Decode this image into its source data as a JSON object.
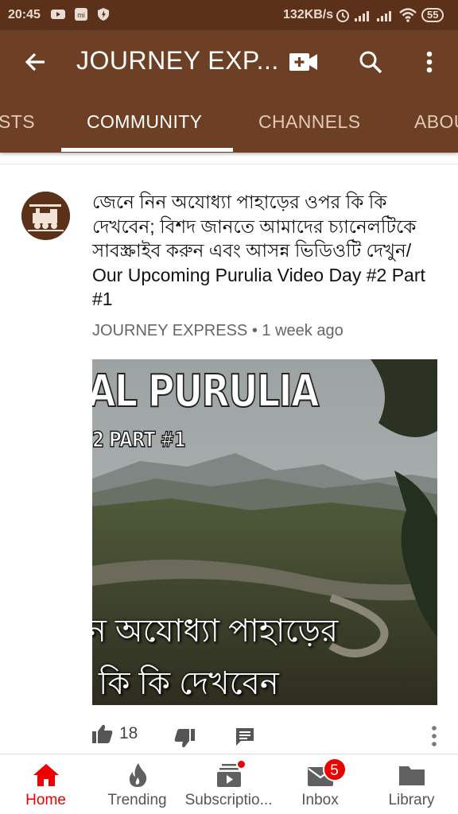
{
  "status_bar": {
    "time": "20:45",
    "network_speed": "132KB/s",
    "battery": "55",
    "icons": [
      "youtube-notif-icon",
      "mi-icon",
      "shield-icon",
      "alarm-icon",
      "signal-icon",
      "signal-icon",
      "wifi-icon",
      "battery-icon"
    ]
  },
  "app_bar": {
    "title": "JOURNEY EXP...",
    "icons": [
      "back-arrow-icon",
      "video-add-icon",
      "search-icon",
      "more-vert-icon"
    ],
    "background": "#6d3f24"
  },
  "tabs": {
    "items": [
      {
        "label": "STS"
      },
      {
        "label": "COMMUNITY"
      },
      {
        "label": "CHANNELS"
      },
      {
        "label": "ABOU"
      }
    ],
    "active": "COMMUNITY"
  },
  "post": {
    "text": "জেনে নিন অযোধ্যা পাহাড়ের ওপর কি কি দেখবেন; বিশদ জানতে আমাদের চ্যানেলটিকে সাবস্ক্রাইব করুন এবং আসন্ন ভিডিওটি দেখুন/ Our Upcoming Purulia Video Day #2 Part #1",
    "author": "JOURNEY EXPRESS",
    "separator": "•",
    "time": "1 week ago",
    "image": {
      "title": "AL PURULIA",
      "subtitle": "2   PART #1",
      "bengali_line1": "ন অযোধ্যা পাহাড়ের",
      "bengali_line2": "কি কি দেখবেন"
    },
    "likes": "18"
  },
  "bottom_nav": {
    "items": [
      {
        "label": "Home",
        "icon": "home-icon"
      },
      {
        "label": "Trending",
        "icon": "trending-icon"
      },
      {
        "label": "Subscriptio...",
        "icon": "subscriptions-icon"
      },
      {
        "label": "Inbox",
        "icon": "inbox-icon",
        "badge": "5"
      },
      {
        "label": "Library",
        "icon": "library-icon"
      }
    ],
    "active": "Home",
    "active_color": "#ee0000"
  }
}
